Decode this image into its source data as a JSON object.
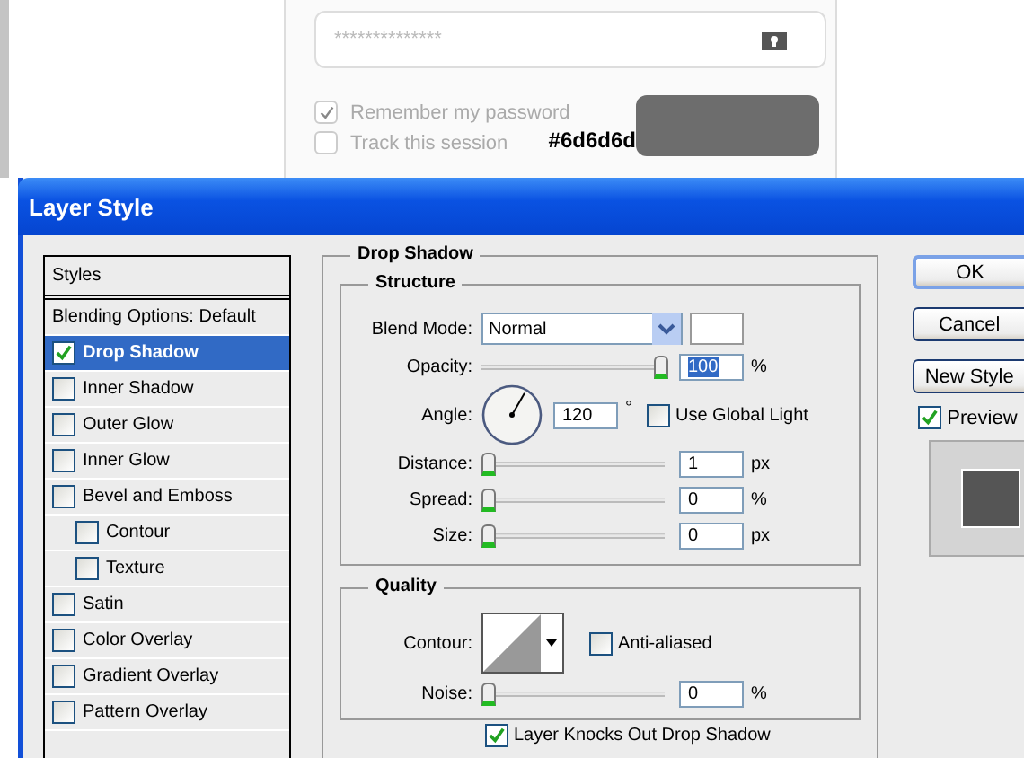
{
  "login": {
    "password": {
      "placeholder": "**************"
    },
    "options": [
      {
        "label": "Remember my password",
        "checked": true
      },
      {
        "label": "Track this session",
        "checked": false
      }
    ],
    "swatch": {
      "label": "#6d6d6d",
      "color": "#6d6d6d"
    }
  },
  "dialog": {
    "title": "Layer Style",
    "styles_header": "Styles",
    "styles": [
      {
        "label": "Blending Options: Default",
        "kind": "plain",
        "selected": false
      },
      {
        "label": "Drop Shadow",
        "kind": "check",
        "selected": true,
        "checked": true
      },
      {
        "label": "Inner Shadow",
        "kind": "check",
        "selected": false,
        "checked": false
      },
      {
        "label": "Outer Glow",
        "kind": "check",
        "selected": false,
        "checked": false
      },
      {
        "label": "Inner Glow",
        "kind": "check",
        "selected": false,
        "checked": false
      },
      {
        "label": "Bevel and Emboss",
        "kind": "check",
        "selected": false,
        "checked": false,
        "children": [
          {
            "label": "Contour",
            "kind": "check",
            "selected": false,
            "checked": false
          },
          {
            "label": "Texture",
            "kind": "check",
            "selected": false,
            "checked": false
          }
        ]
      },
      {
        "label": "Satin",
        "kind": "check",
        "selected": false,
        "checked": false
      },
      {
        "label": "Color Overlay",
        "kind": "check",
        "selected": false,
        "checked": false
      },
      {
        "label": "Gradient Overlay",
        "kind": "check",
        "selected": false,
        "checked": false
      },
      {
        "label": "Pattern Overlay",
        "kind": "check",
        "selected": false,
        "checked": false
      }
    ],
    "section_title": "Drop Shadow",
    "structure": {
      "title": "Structure",
      "blend_label": "Blend Mode:",
      "blend_value": "Normal",
      "opacity": {
        "label": "Opacity:",
        "level": 1,
        "value": "100",
        "unit": "%"
      },
      "angle": {
        "label": "Angle:",
        "value": "120",
        "unit": "°",
        "global_light": {
          "label": "Use Global Light",
          "checked": false
        }
      },
      "sliders": [
        {
          "label": "Distance:",
          "level": 0,
          "value": "1",
          "unit": "px"
        },
        {
          "label": "Spread:",
          "level": 0,
          "value": "0",
          "unit": "%"
        },
        {
          "label": "Size:",
          "level": 0,
          "value": "0",
          "unit": "px"
        }
      ]
    },
    "quality": {
      "title": "Quality",
      "contour_label": "Contour:",
      "anti_aliased": {
        "label": "Anti-aliased",
        "checked": false
      },
      "noise": {
        "label": "Noise:",
        "level": 0,
        "value": "0",
        "unit": "%"
      }
    },
    "knockout": {
      "label": "Layer Knocks Out Drop Shadow",
      "checked": true
    },
    "buttons": [
      "OK",
      "Cancel",
      "New Style"
    ],
    "preview": {
      "label": "Preview",
      "checked": true
    }
  }
}
